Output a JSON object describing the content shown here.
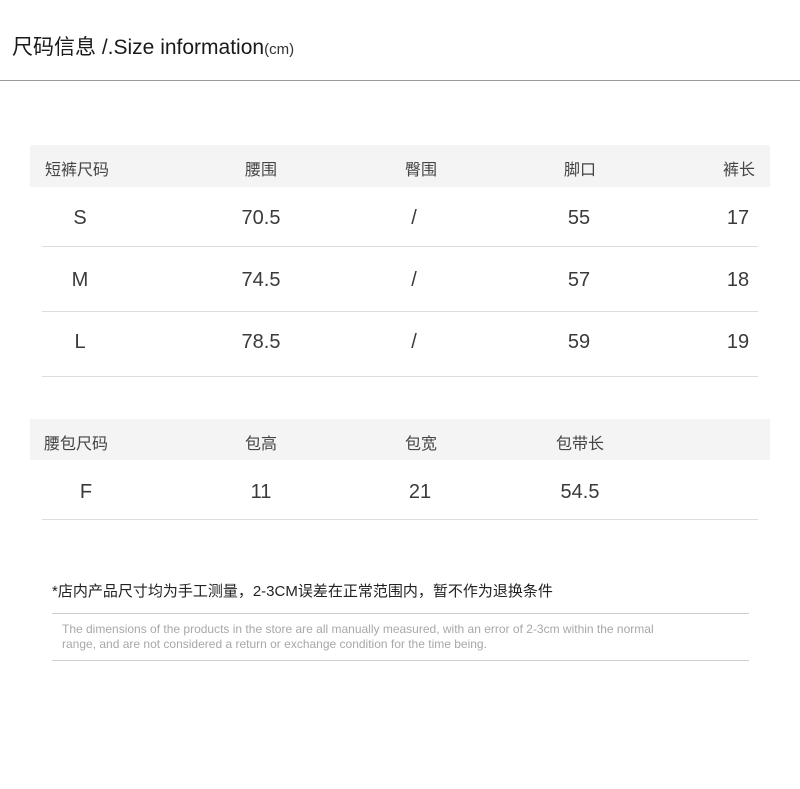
{
  "header": {
    "title": "尺码信息 /.Size information",
    "unit": "(cm)"
  },
  "shorts_table": {
    "headers": [
      "短裤尺码",
      "腰围",
      "臀围",
      "脚口",
      "裤长"
    ],
    "rows": [
      [
        "S",
        "70.5",
        "/",
        "55",
        "17"
      ],
      [
        "M",
        "74.5",
        "/",
        "57",
        "18"
      ],
      [
        "L",
        "78.5",
        "/",
        "59",
        "19"
      ]
    ]
  },
  "bag_table": {
    "headers": [
      "腰包尺码",
      "包高",
      "包宽",
      "包带长"
    ],
    "rows": [
      [
        "F",
        "11",
        "21",
        "54.5"
      ]
    ]
  },
  "note": {
    "cn": "*店内产品尺寸均为手工测量，2-3CM误差在正常范围内，暂不作为退换条件",
    "en": "The dimensions of the products in the store are all manually measured, with an error of 2-3cm within the normal range, and are not considered a return or exchange condition for the time being."
  },
  "colors": {
    "background": "#ffffff",
    "header_band": "#f4f4f4",
    "text": "#333333",
    "muted_text": "#a8a8a8",
    "rule": "#9a9a9a"
  }
}
